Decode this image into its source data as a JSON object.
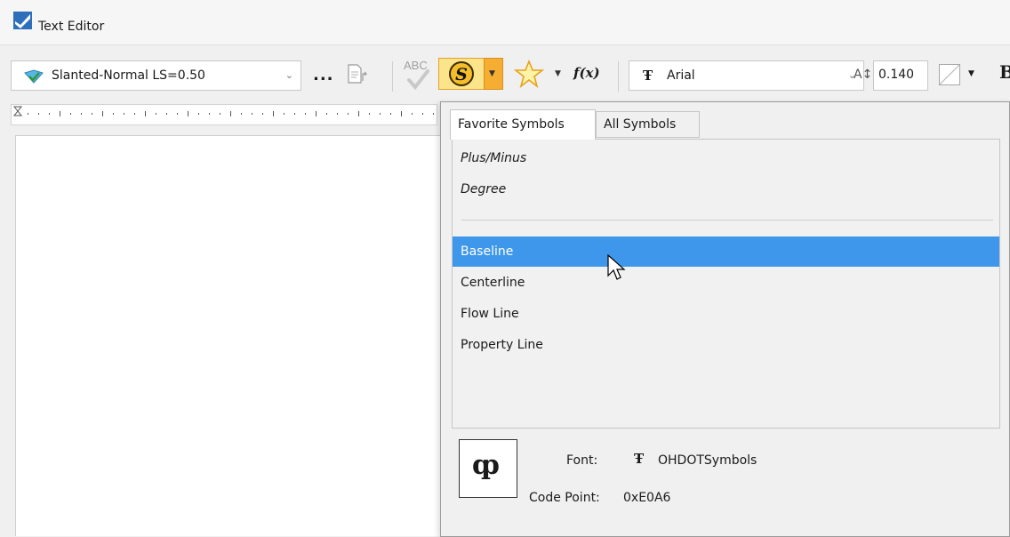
{
  "window": {
    "title": "Text Editor"
  },
  "toolbar": {
    "text_style": "Slanted-Normal LS=0.50",
    "more_label": "...",
    "spell_label": "ABC",
    "font": "Arial",
    "text_height": "0.140",
    "font_icon_glyph": "Ŧ"
  },
  "popup": {
    "tabs": [
      {
        "label": "Favorite Symbols",
        "active": true
      },
      {
        "label": "All Symbols",
        "active": false
      }
    ],
    "favorites": [
      {
        "label": "Plus/Minus"
      },
      {
        "label": "Degree"
      }
    ],
    "symbols": [
      {
        "label": "Baseline",
        "selected": true
      },
      {
        "label": "Centerline",
        "selected": false
      },
      {
        "label": "Flow Line",
        "selected": false
      },
      {
        "label": "Property Line",
        "selected": false
      }
    ],
    "preview": {
      "glyph": "ȹ",
      "font_label": "Font:",
      "font_value": "OHDOTSymbols",
      "code_point_label": "Code Point:",
      "code_point_value": "0xE0A6"
    }
  },
  "colors": {
    "selection": "#3e97ea",
    "symbol_button": "#fce48a",
    "symbol_button_dropdown": "#f5ad32"
  }
}
